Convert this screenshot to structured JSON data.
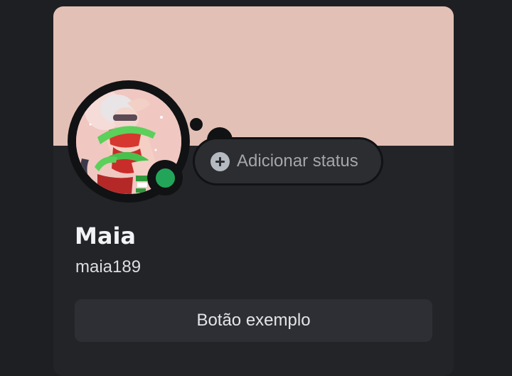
{
  "profile": {
    "display_name": "Maia",
    "username": "maia189",
    "online_status": "online",
    "status_prompt": "Adicionar status",
    "button_label": "Botão exemplo"
  },
  "icons": {
    "status_add": "plus-circle-icon",
    "presence": "online-dot-icon"
  },
  "colors": {
    "background": "#1e1f22",
    "card": "#232428",
    "banner": "#e3c0b6",
    "online": "#23a559",
    "pill": "#2b2d31",
    "button": "#2e2f34"
  }
}
